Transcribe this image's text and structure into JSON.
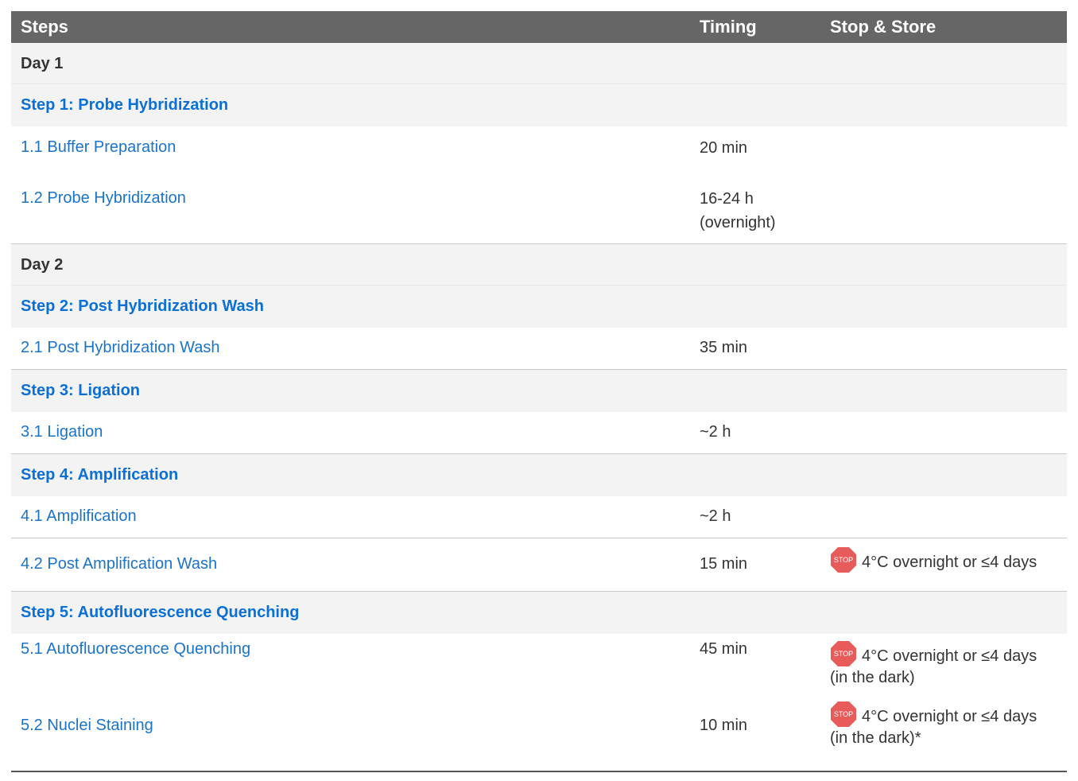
{
  "header": {
    "steps": "Steps",
    "timing": "Timing",
    "stop_store": "Stop & Store"
  },
  "stop_label": "STOP",
  "colors": {
    "header_bg": "#666666",
    "step_blue": "#0a6fd6",
    "stop_red": "#e85b5b"
  },
  "rows": {
    "day1": "Day 1",
    "step1": "Step 1: Probe Hybridization",
    "s11": {
      "name": "1.1 Buffer Preparation",
      "time": "20 min"
    },
    "s12": {
      "name": "1.2 Probe Hybridization",
      "time_line1": "16-24 h",
      "time_line2": "(overnight)"
    },
    "day2": "Day 2",
    "step2": "Step 2: Post Hybridization Wash",
    "s21": {
      "name": "2.1 Post Hybridization Wash",
      "time": "35 min"
    },
    "step3": "Step 3: Ligation",
    "s31": {
      "name": "3.1 Ligation",
      "time": "~2 h"
    },
    "step4": "Step 4: Amplification",
    "s41": {
      "name": "4.1 Amplification",
      "time": "~2 h"
    },
    "s42": {
      "name": "4.2 Post Amplification Wash",
      "time": "15 min",
      "store": "4°C overnight or ≤4 days"
    },
    "step5": "Step 5: Autofluorescence Quenching",
    "s51": {
      "name": "5.1 Autofluorescence Quenching",
      "time": "45 min",
      "store_line1": "4°C overnight or ≤4 days",
      "store_line2": "(in the dark)"
    },
    "s52": {
      "name": "5.2 Nuclei Staining",
      "time": "10 min",
      "store_line1": "4°C overnight or ≤4 days",
      "store_line2": "(in the dark)*"
    }
  }
}
